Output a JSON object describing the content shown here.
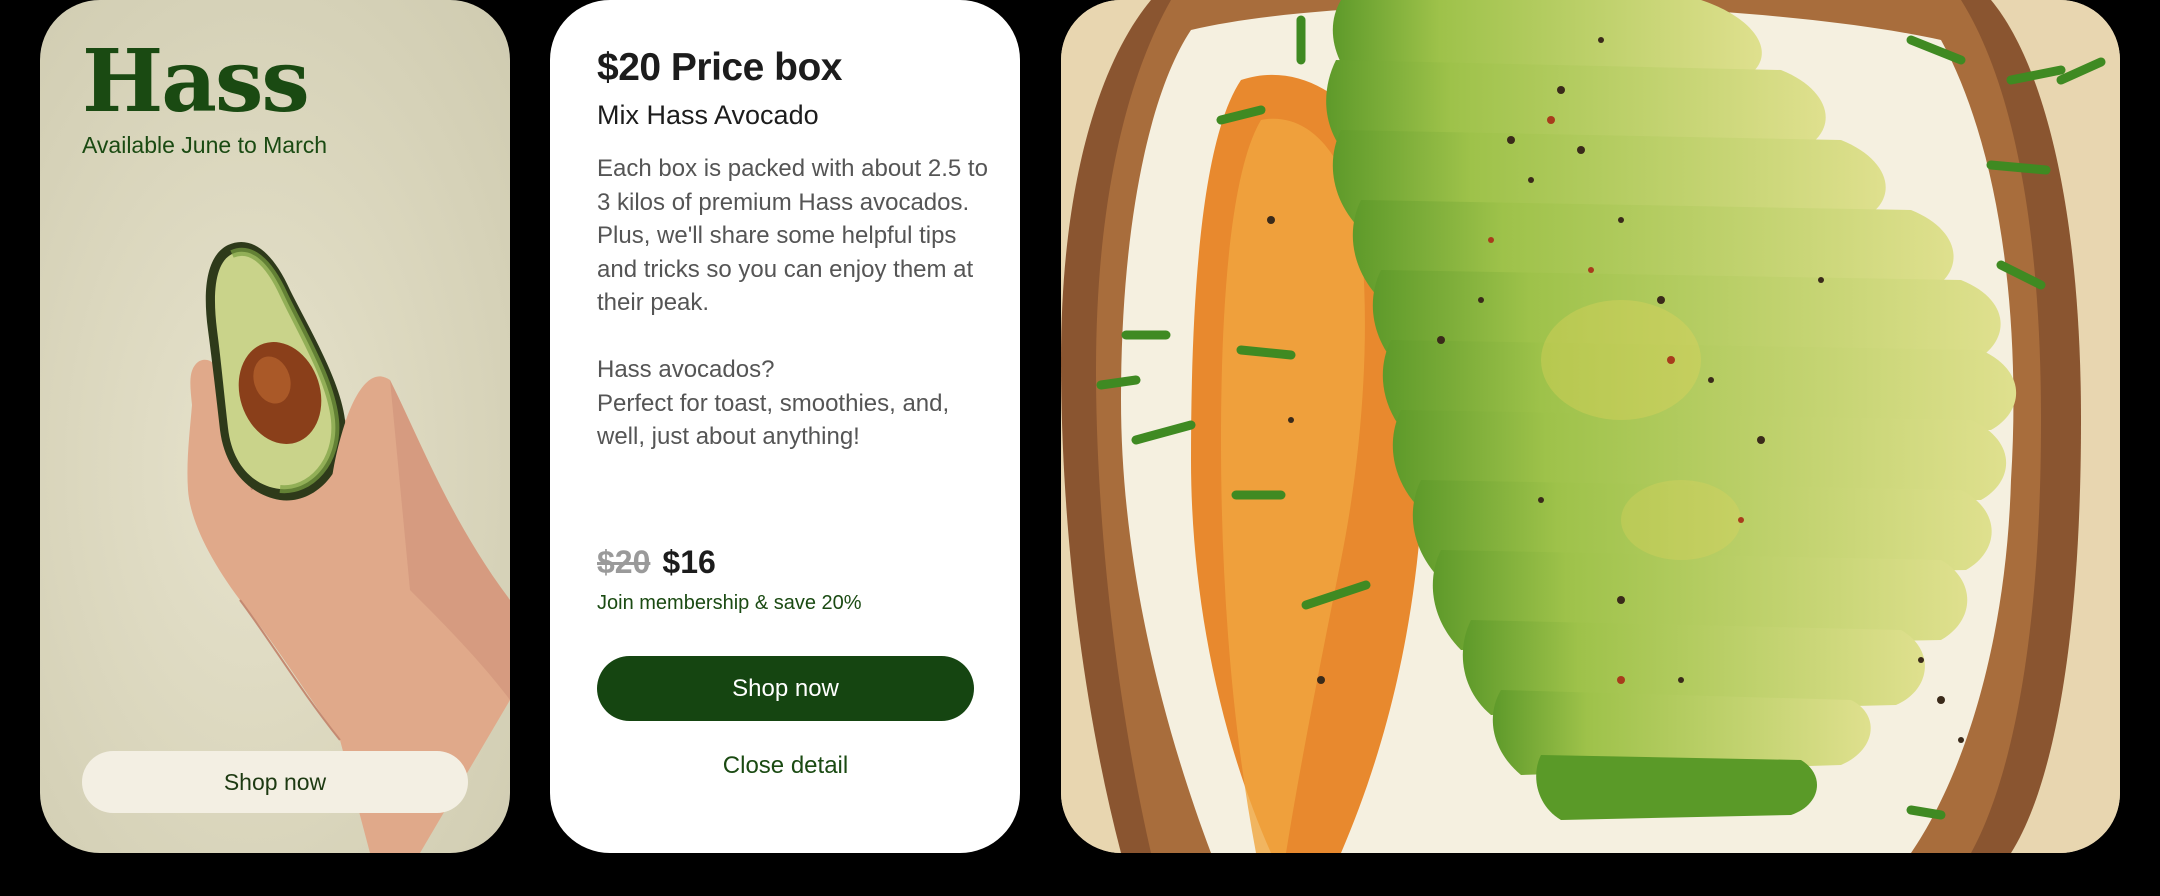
{
  "hass_card": {
    "title": "Hass",
    "subtitle": "Available June to March",
    "shop_label": "Shop now"
  },
  "detail_card": {
    "title": "$20 Price box",
    "subtitle": "Mix Hass Avocado",
    "description_1": "Each box is packed with about 2.5 to 3 kilos of premium Hass avocados.  Plus, we'll share some helpful tips and tricks so you can enjoy them at their peak.",
    "description_2": "Hass avocados?",
    "description_3": "Perfect for toast, smoothies, and, well, just about anything!",
    "price_original": "$20",
    "price_current": "$16",
    "membership_text": "Join membership & save 20%",
    "shop_label": "Shop now",
    "close_label": "Close detail"
  },
  "colors": {
    "brand_green": "#154511",
    "text_green": "#1a4a12",
    "background": "#000000",
    "card_beige": "#dcd8bf",
    "button_cream": "#f3efe3"
  },
  "icons": [
    "avocado-half-illustration",
    "hand-illustration",
    "avocado-toast-photo"
  ]
}
